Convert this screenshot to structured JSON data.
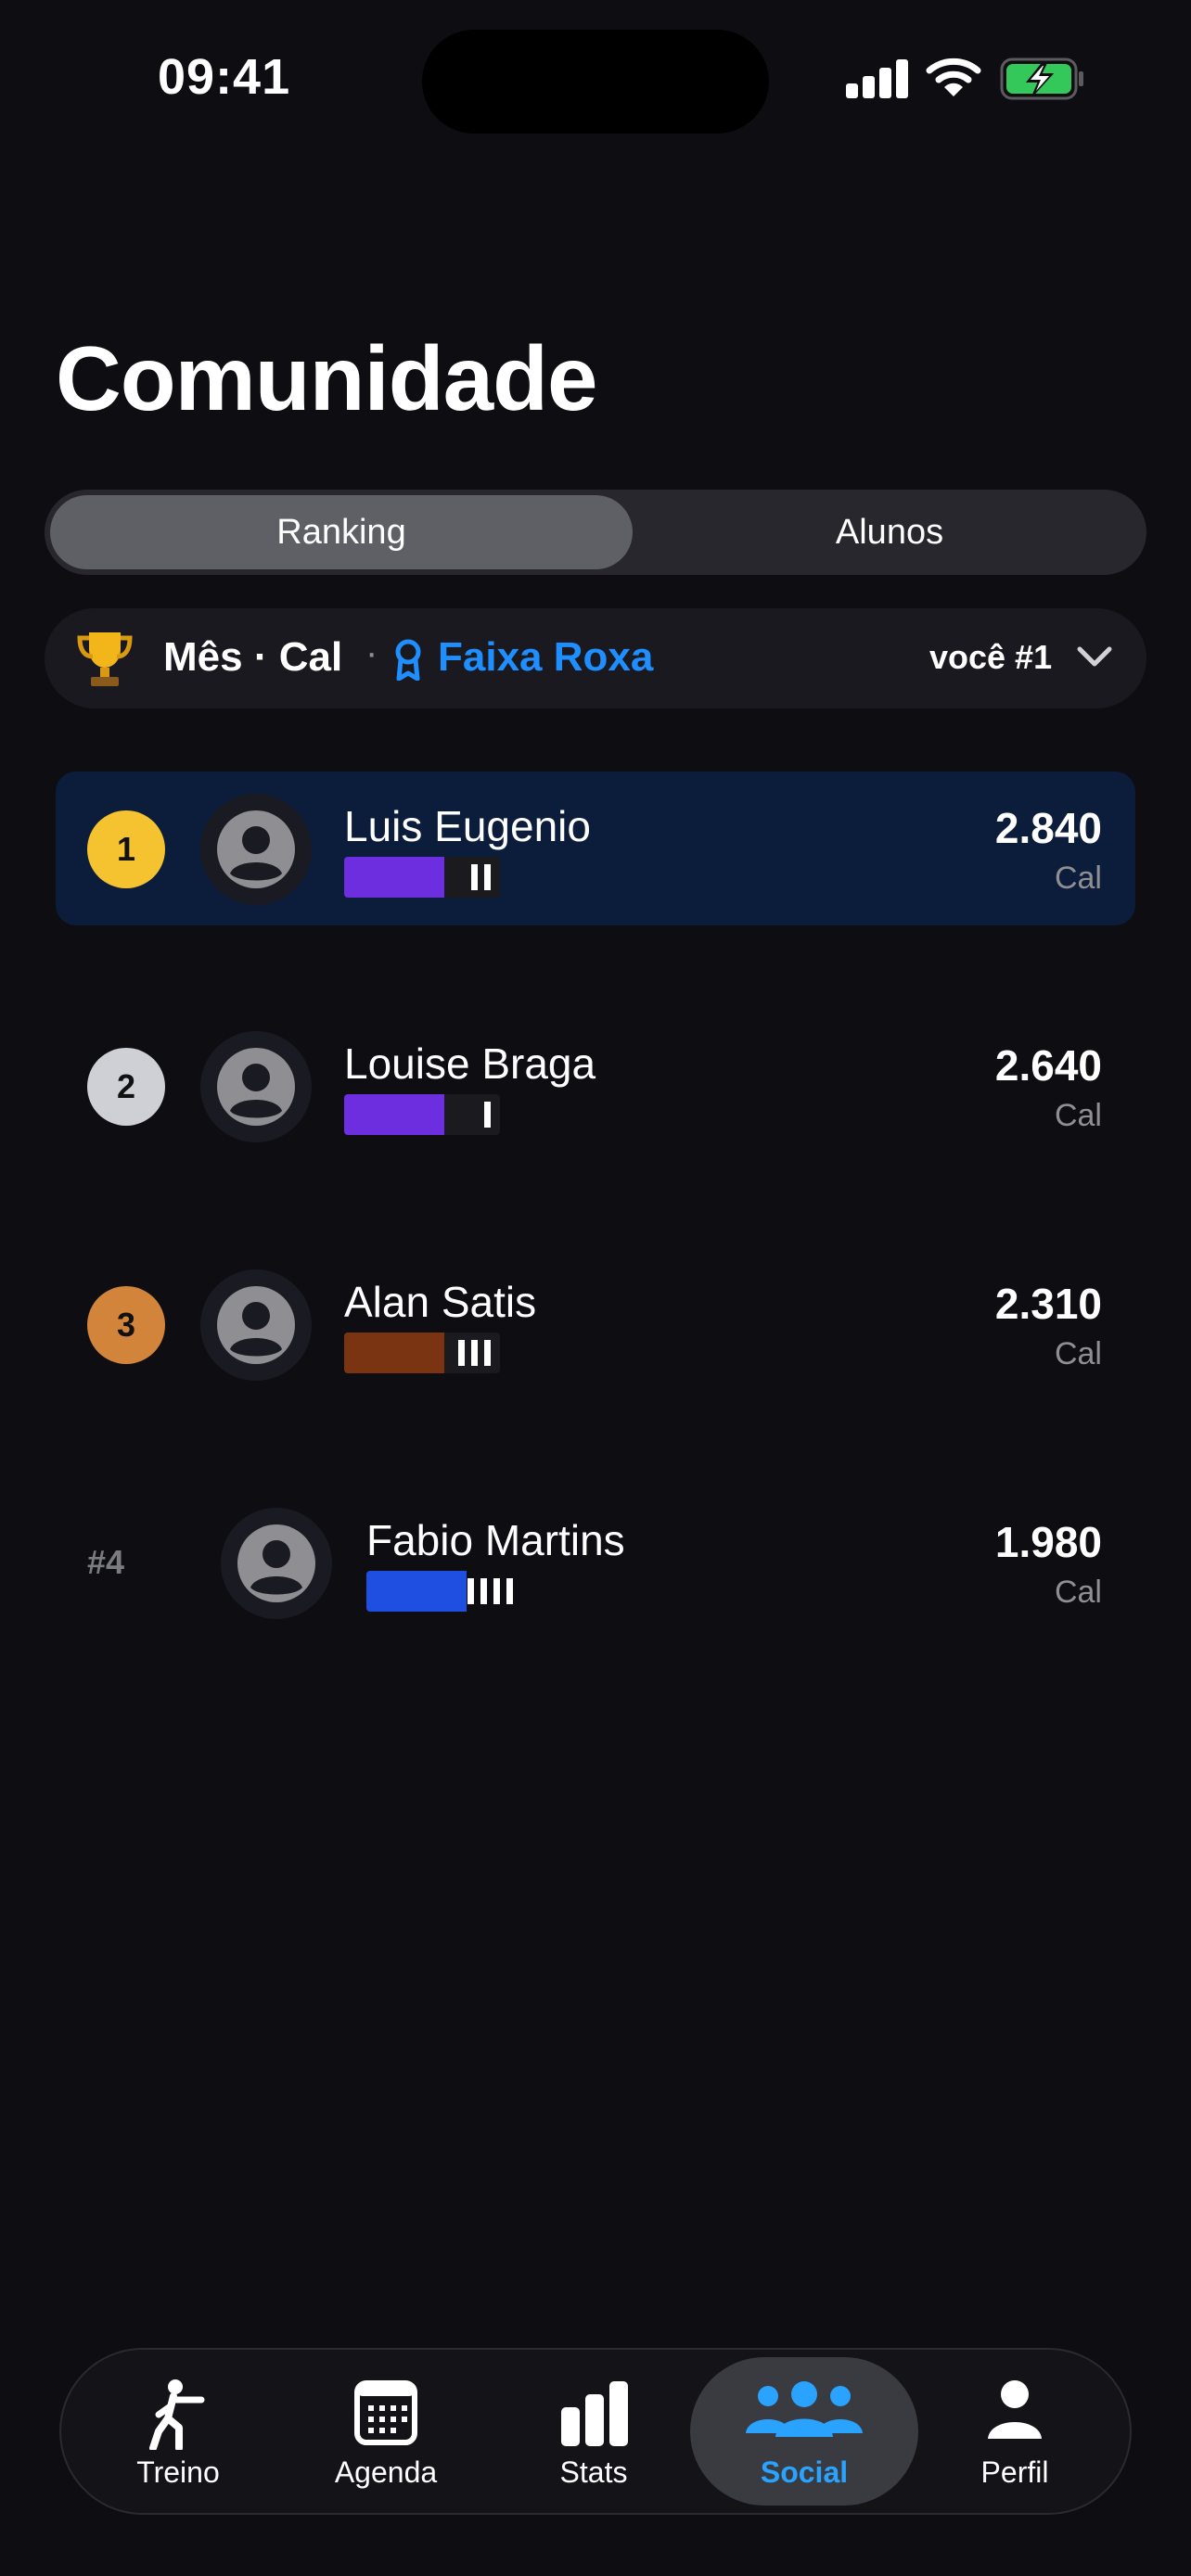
{
  "status_bar": {
    "time": "09:41"
  },
  "title": "Comunidade",
  "segmented": {
    "ranking": "Ranking",
    "alunos": "Alunos"
  },
  "filter": {
    "period": "Mês · Cal",
    "separator": "·",
    "belt": "Faixa Roxa",
    "you_rank": "você #1"
  },
  "ranking": [
    {
      "rank_label": "1",
      "name": "Luis Eugenio",
      "score": "2.840",
      "unit": "Cal",
      "belt_color": "#6d2ee0",
      "stripes": 2,
      "medal_color": "#f5c230",
      "highlight": true
    },
    {
      "rank_label": "2",
      "name": "Louise Braga",
      "score": "2.640",
      "unit": "Cal",
      "belt_color": "#6d2ee0",
      "stripes": 1,
      "medal_color": "#cfcfd6",
      "highlight": false
    },
    {
      "rank_label": "3",
      "name": "Alan Satis",
      "score": "2.310",
      "unit": "Cal",
      "belt_color": "#7a3412",
      "stripes": 3,
      "medal_color": "#d2843a",
      "highlight": false
    },
    {
      "rank_label": "#4",
      "name": "Fabio Martins",
      "score": "1.980",
      "unit": "Cal",
      "belt_color": "#1f4fe0",
      "stripes": 4,
      "medal_color": "",
      "highlight": false
    }
  ],
  "tabbar": {
    "items": [
      {
        "label": "Treino",
        "icon": "training-icon"
      },
      {
        "label": "Agenda",
        "icon": "calendar-icon"
      },
      {
        "label": "Stats",
        "icon": "stats-icon"
      },
      {
        "label": "Social",
        "icon": "people-icon",
        "active": true
      },
      {
        "label": "Perfil",
        "icon": "person-icon"
      }
    ]
  },
  "colors": {
    "accent": "#2aa3ff",
    "belt_label": "#1f8fff",
    "background": "#0d0d12"
  }
}
